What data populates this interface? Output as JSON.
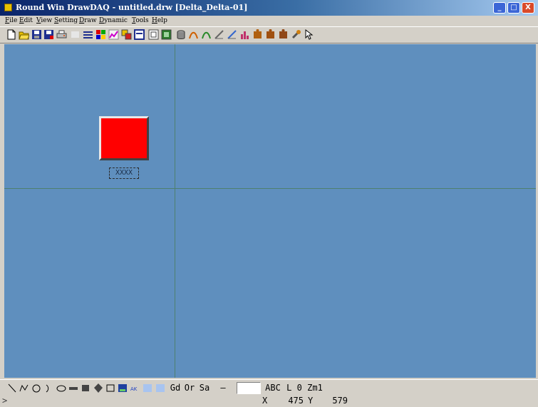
{
  "window": {
    "title": "Round Win DrawDAQ - untitled.drw [Delta_Delta-01]",
    "minimize": "_",
    "maximize": "□",
    "close": "X"
  },
  "menu": [
    "File",
    "Edit",
    "View",
    "Setting",
    "Draw",
    "Dynamic",
    "Tools",
    "Help"
  ],
  "canvas": {
    "tag_label": "XXXX",
    "background_color": "#5f8fbe",
    "block_color": "#ff0000"
  },
  "bottom_toolbar": {
    "gd": "Gd",
    "or": "Or",
    "sa": "Sa",
    "line_style": "—",
    "text_style": "ABC",
    "layer": "L 0",
    "zoom": "Zm1"
  },
  "status": {
    "prompt": ">",
    "x_label": "X",
    "x_value": "475",
    "y_label": "Y",
    "y_value": "579"
  }
}
